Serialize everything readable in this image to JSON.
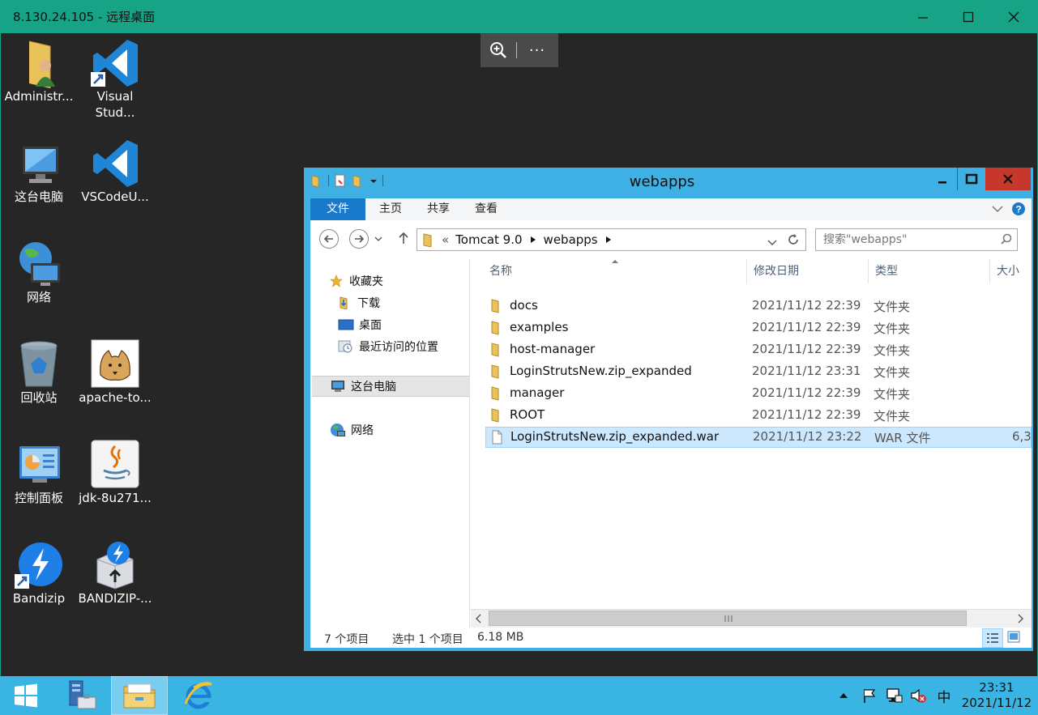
{
  "remote": {
    "title": "8.130.24.105 - 远程桌面",
    "more_label": "···"
  },
  "desktop": {
    "icons": [
      {
        "label": "Administr..."
      },
      {
        "label": "Visual Stud..."
      },
      {
        "label": "这台电脑"
      },
      {
        "label": "VSCodeU..."
      },
      {
        "label": "网络"
      },
      {
        "label": "回收站"
      },
      {
        "label": "apache-to..."
      },
      {
        "label": "控制面板"
      },
      {
        "label": "jdk-8u271..."
      },
      {
        "label": "Bandizip"
      },
      {
        "label": "BANDIZIP-..."
      }
    ]
  },
  "explorer": {
    "title": "webapps",
    "ribbon_tabs": [
      "文件",
      "主页",
      "共享",
      "查看"
    ],
    "breadcrumb": {
      "overflow": "«",
      "parts": [
        "Tomcat 9.0",
        "webapps"
      ]
    },
    "search_placeholder": "搜索\"webapps\"",
    "nav": {
      "favorites": "收藏夹",
      "downloads": "下载",
      "desktop": "桌面",
      "recent": "最近访问的位置",
      "this_pc": "这台电脑",
      "network": "网络"
    },
    "columns": {
      "name": "名称",
      "date": "修改日期",
      "type": "类型",
      "size": "大小"
    },
    "files": [
      {
        "name": "docs",
        "date": "2021/11/12 22:39",
        "type": "文件夹",
        "size": ""
      },
      {
        "name": "examples",
        "date": "2021/11/12 22:39",
        "type": "文件夹",
        "size": ""
      },
      {
        "name": "host-manager",
        "date": "2021/11/12 22:39",
        "type": "文件夹",
        "size": ""
      },
      {
        "name": "LoginStrutsNew.zip_expanded",
        "date": "2021/11/12 23:31",
        "type": "文件夹",
        "size": ""
      },
      {
        "name": "manager",
        "date": "2021/11/12 22:39",
        "type": "文件夹",
        "size": ""
      },
      {
        "name": "ROOT",
        "date": "2021/11/12 22:39",
        "type": "文件夹",
        "size": ""
      },
      {
        "name": "LoginStrutsNew.zip_expanded.war",
        "date": "2021/11/12 23:22",
        "type": "WAR 文件",
        "size": "6,3"
      }
    ],
    "status": {
      "count": "7 个项目",
      "selected": "选中 1 个项目",
      "size": "6.18 MB"
    }
  },
  "taskbar": {
    "clock_time": "23:31",
    "clock_date": "2021/11/12",
    "ime": "中"
  },
  "colors": {
    "accent": "#17a386",
    "window_frame": "#3fb0e4",
    "ribbon_active": "#1979ca",
    "taskbar": "#3ab5e3",
    "selection": "#cce8ff"
  }
}
